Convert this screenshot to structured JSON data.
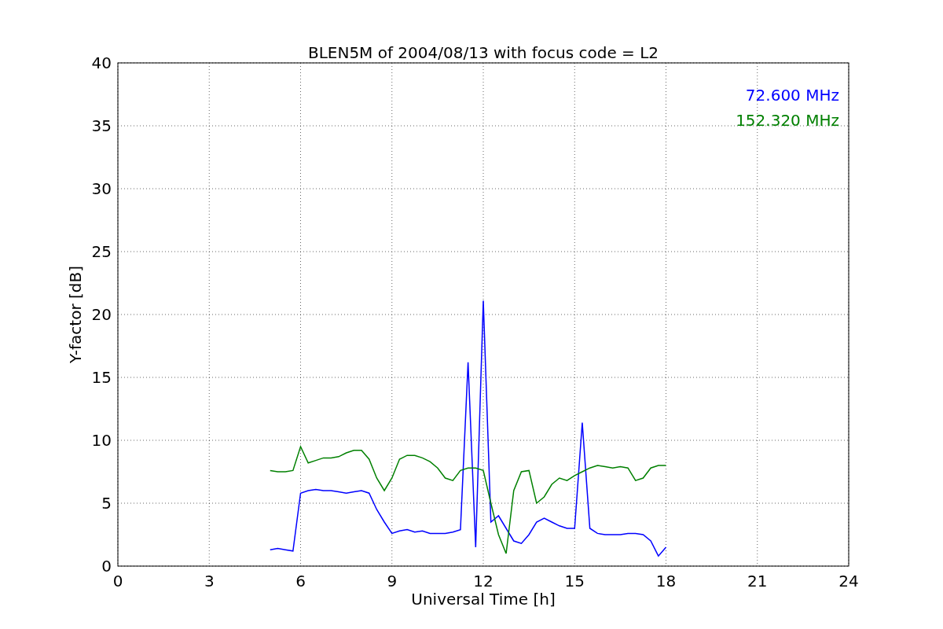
{
  "chart_data": {
    "type": "line",
    "title": "BLEN5M of 2004/08/13 with focus code = L2",
    "xlabel": "Universal Time [h]",
    "ylabel": "Y-factor [dB]",
    "x": [
      5,
      5.25,
      5.5,
      5.75,
      6,
      6.25,
      6.5,
      6.75,
      7,
      7.25,
      7.5,
      7.75,
      8,
      8.25,
      8.5,
      8.75,
      9,
      9.25,
      9.5,
      9.75,
      10,
      10.25,
      10.5,
      10.75,
      11,
      11.25,
      11.5,
      11.75,
      12,
      12.25,
      12.5,
      12.75,
      13,
      13.25,
      13.5,
      13.75,
      14,
      14.25,
      14.5,
      14.75,
      15,
      15.25,
      15.5,
      15.75,
      16,
      16.25,
      16.5,
      16.75,
      17,
      17.25,
      17.5,
      17.75,
      18
    ],
    "series": [
      {
        "name": "72.600 MHz",
        "color": "#0000ff",
        "values": [
          1.3,
          1.4,
          1.3,
          1.2,
          5.8,
          6.0,
          6.1,
          6.0,
          6.0,
          5.9,
          5.8,
          5.9,
          6.0,
          5.8,
          4.5,
          3.5,
          2.6,
          2.8,
          2.9,
          2.7,
          2.8,
          2.6,
          2.6,
          2.6,
          2.7,
          2.9,
          16.2,
          1.5,
          21.1,
          3.5,
          4.0,
          3.0,
          2.0,
          1.8,
          2.5,
          3.5,
          3.8,
          3.5,
          3.2,
          3.0,
          3.0,
          11.4,
          3.0,
          2.6,
          2.5,
          2.5,
          2.5,
          2.6,
          2.6,
          2.5,
          2.0,
          0.8,
          1.5
        ]
      },
      {
        "name": "152.320 MHz",
        "color": "#008000",
        "values": [
          7.6,
          7.5,
          7.5,
          7.6,
          9.5,
          8.2,
          8.4,
          8.6,
          8.6,
          8.7,
          9.0,
          9.2,
          9.2,
          8.5,
          7.0,
          6.0,
          7.0,
          8.5,
          8.8,
          8.8,
          8.6,
          8.3,
          7.8,
          7.0,
          6.8,
          7.6,
          7.8,
          7.8,
          7.6,
          5.0,
          2.5,
          1.0,
          6.0,
          7.5,
          7.6,
          5.0,
          5.5,
          6.5,
          7.0,
          6.8,
          7.2,
          7.5,
          7.8,
          8.0,
          7.9,
          7.8,
          7.9,
          7.8,
          6.8,
          7.0,
          7.8,
          8.0,
          8.0
        ]
      }
    ],
    "grid": true,
    "xlim": [
      0,
      24
    ],
    "ylim": [
      0,
      40
    ],
    "xticks": [
      0,
      3,
      6,
      9,
      12,
      15,
      18,
      21,
      24
    ],
    "yticks": [
      0,
      5,
      10,
      15,
      20,
      25,
      30,
      35,
      40
    ]
  }
}
